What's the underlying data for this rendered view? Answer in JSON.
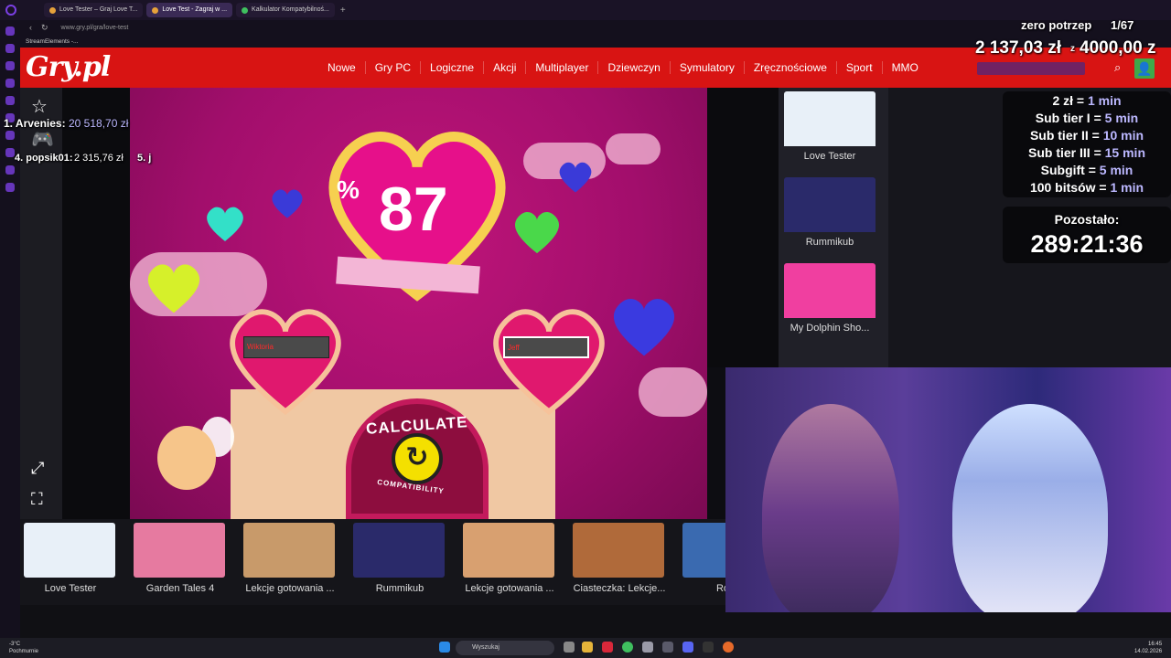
{
  "browser": {
    "tabs": [
      {
        "label": "Love Tester – Graj Love T..."
      },
      {
        "label": "Love Test - Zagraj w ..."
      },
      {
        "label": "Kalkulator Kompatybilnoś..."
      }
    ],
    "new_tab": "+",
    "url": "www.gry.pl/gra/love-test",
    "bookmark": "StreamElements -..."
  },
  "site": {
    "logo": "Gry.pl",
    "nav": [
      "Nowe",
      "Gry PC",
      "Logiczne",
      "Akcji",
      "Multiplayer",
      "Dziewczyn",
      "Symulatory",
      "Zręcznościowe",
      "Sport",
      "MMO"
    ]
  },
  "game": {
    "percent_sign": "%",
    "score": "87",
    "name_left": "Wiktoria",
    "name_right": "Jeff",
    "calc_line1": "CALCULATE",
    "calc_line2": "COMPATIBILITY"
  },
  "right_cards": [
    {
      "label": "Love Tester",
      "color": "#e8f0f8"
    },
    {
      "label": "Rummikub",
      "color": "#2a2a6a"
    },
    {
      "label": "My Dolphin Sho...",
      "color": "#f03fa0"
    }
  ],
  "bottom_cards": [
    {
      "label": "Love Tester",
      "color": "#e8f0f8"
    },
    {
      "label": "Garden Tales 4",
      "color": "#e67aa0"
    },
    {
      "label": "Lekcje gotowania ...",
      "color": "#c89a6a"
    },
    {
      "label": "Rummikub",
      "color": "#2a2a6a"
    },
    {
      "label": "Lekcje gotowania ...",
      "color": "#d8a070"
    },
    {
      "label": "Ciasteczka: Lekcje...",
      "color": "#b06a3a"
    },
    {
      "label": "Royal",
      "color": "#3a6ab0"
    }
  ],
  "overlay": {
    "goal_title": "zero potrzep",
    "goal_progress": "1/67",
    "money": "2 137,03 zł",
    "money_sep": "z",
    "money_goal": "4000,00 z",
    "leader1_rank": "1. Arvenies:",
    "leader1_value": "20 518,70 zł",
    "leader4_rank": "4. popsik01:",
    "leader4_value": "2 315,76 zł",
    "leader5_rank": "5. j",
    "rates": [
      {
        "left": "2 zł =",
        "right": "1 min"
      },
      {
        "left": "Sub tier I =",
        "right": "5 min"
      },
      {
        "left": "Sub tier II =",
        "right": "10 min"
      },
      {
        "left": "Sub tier III =",
        "right": "15 min"
      },
      {
        "left": "Subgift =",
        "right": "5 min"
      },
      {
        "left": "100 bitsów =",
        "right": "1 min"
      }
    ],
    "timer_label": "Pozostało:",
    "timer_value": "289:21:36"
  },
  "taskbar": {
    "weather_temp": "-3°C",
    "weather_desc": "Pochmurnie",
    "search": "Wyszukaj",
    "time": "16:45",
    "date": "14.02.2026"
  }
}
